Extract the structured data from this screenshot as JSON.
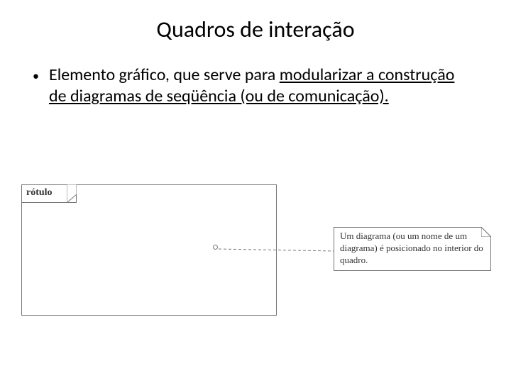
{
  "title": "Quadros de interação",
  "bullet": {
    "plain_start": "Elemento gráfico, que serve para ",
    "underlined": "modularizar a construção de diagramas de seqüência (ou de comunicação)."
  },
  "diagram": {
    "label": "rótulo",
    "note": "Um diagrama (ou um nome de um diagrama) é posicionado no interior do quadro."
  }
}
